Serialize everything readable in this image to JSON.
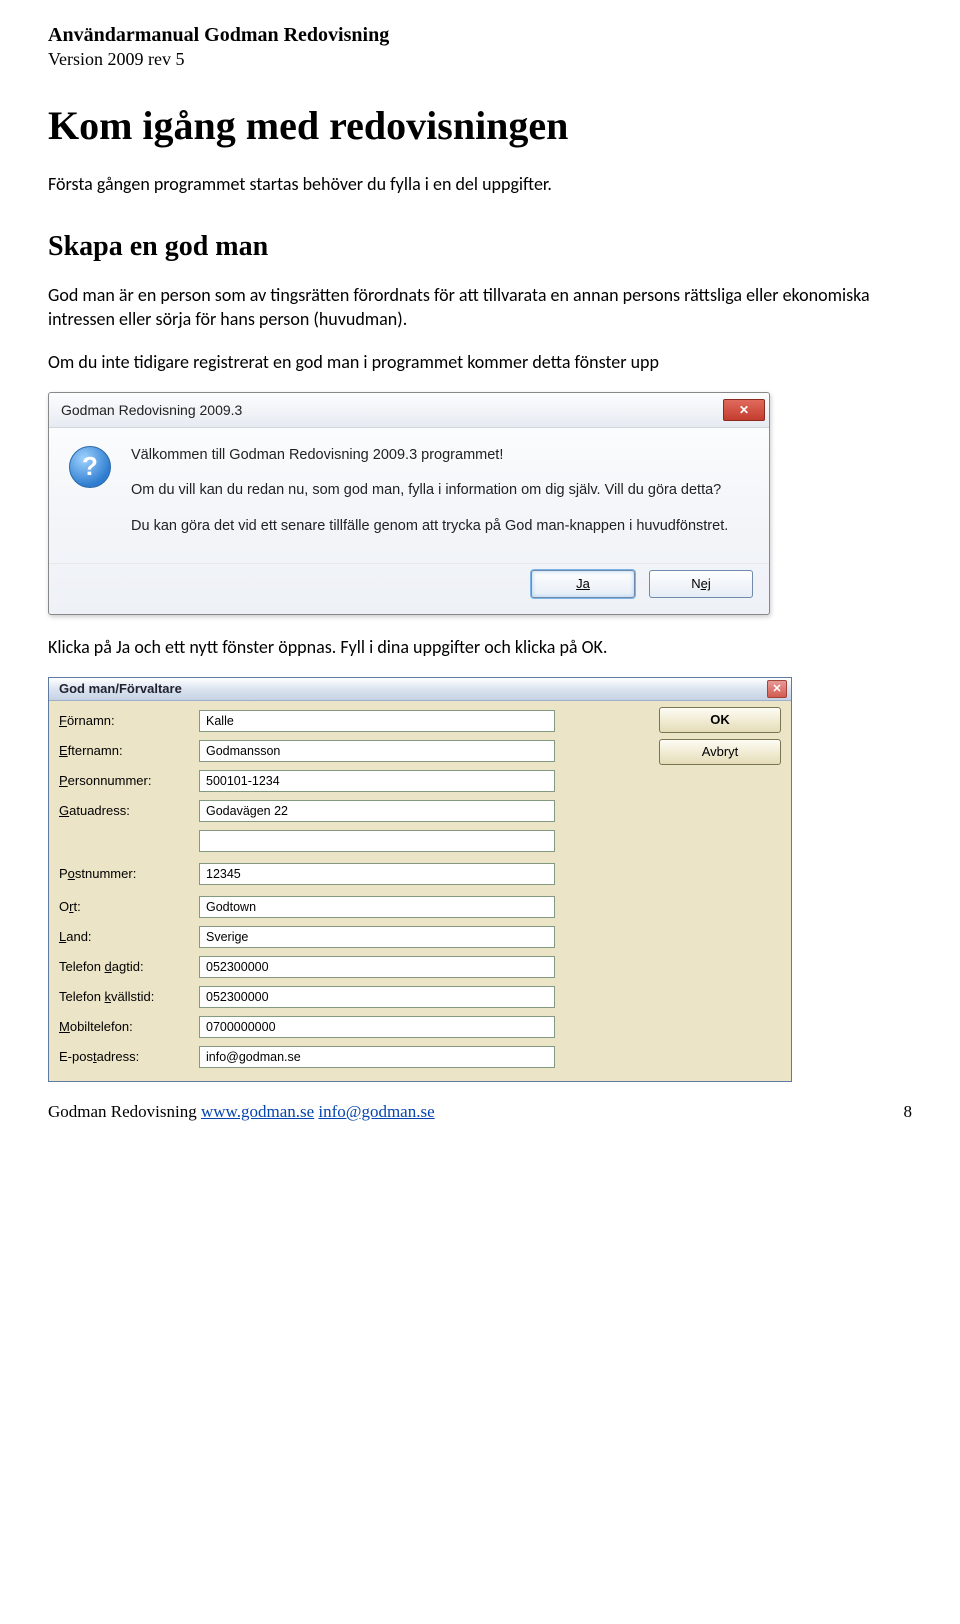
{
  "header": {
    "title": "Användarmanual Godman Redovisning",
    "subtitle": "Version 2009 rev 5"
  },
  "h1": "Kom igång med redovisningen",
  "intro": "Första gången programmet startas behöver du fylla i en del uppgifter.",
  "h2": "Skapa en god man",
  "para1": "God man är en person som av tingsrätten förordnats för att tillvarata en annan persons rättsliga eller ekonomiska intressen eller sörja för hans person (huvudman).",
  "para2": "Om du inte tidigare registrerat en god man i programmet kommer detta fönster upp",
  "dialog1": {
    "title": "Godman Redovisning 2009.3",
    "line1": "Välkommen till Godman Redovisning 2009.3 programmet!",
    "line2": "Om du vill kan du redan nu, som god man, fylla i information om dig själv. Vill du göra detta?",
    "line3": "Du kan göra det vid ett senare tillfälle genom att trycka på God man-knappen i huvudfönstret.",
    "yes": "Ja",
    "no_prefix": "N",
    "no_rest": "ej"
  },
  "para3": "Klicka på Ja och ett nytt fönster öppnas. Fyll i dina uppgifter och klicka på OK.",
  "dialog2": {
    "title": "God man/Förvaltare",
    "ok": "OK",
    "cancel": "Avbryt",
    "fields": {
      "fornamn": {
        "label_html": "<span class='ul'>F</span>örnamn:",
        "value": "Kalle"
      },
      "efternamn": {
        "label_html": "<span class='ul'>E</span>fternamn:",
        "value": "Godmansson"
      },
      "personnummer": {
        "label_html": "<span class='ul'>P</span>ersonnummer:",
        "value": "500101-1234"
      },
      "gatuadress": {
        "label_html": "<span class='ul'>G</span>atuadress:",
        "value": "Godavägen 22"
      },
      "gatuadress2": {
        "label_html": "",
        "value": ""
      },
      "postnummer": {
        "label_html": "P<span class='ul'>o</span>stnummer:",
        "value": "12345"
      },
      "ort": {
        "label_html": "O<span class='ul'>r</span>t:",
        "value": "Godtown"
      },
      "land": {
        "label_html": "<span class='ul'>L</span>and:",
        "value": "Sverige"
      },
      "tel_dag": {
        "label_html": "Telefon <span class='ul'>d</span>agtid:",
        "value": "052300000"
      },
      "tel_kvall": {
        "label_html": "Telefon <span class='ul'>k</span>vällstid:",
        "value": "052300000"
      },
      "mobil": {
        "label_html": "<span class='ul'>M</span>obiltelefon:",
        "value": "0700000000"
      },
      "epost": {
        "label_html": "E-pos<span class='ul'>t</span>adress:",
        "value": "info@godman.se"
      }
    }
  },
  "footer": {
    "product": "Godman Redovisning ",
    "url_text": "www.godman.se",
    "email": "info@godman.se",
    "page": "8"
  }
}
